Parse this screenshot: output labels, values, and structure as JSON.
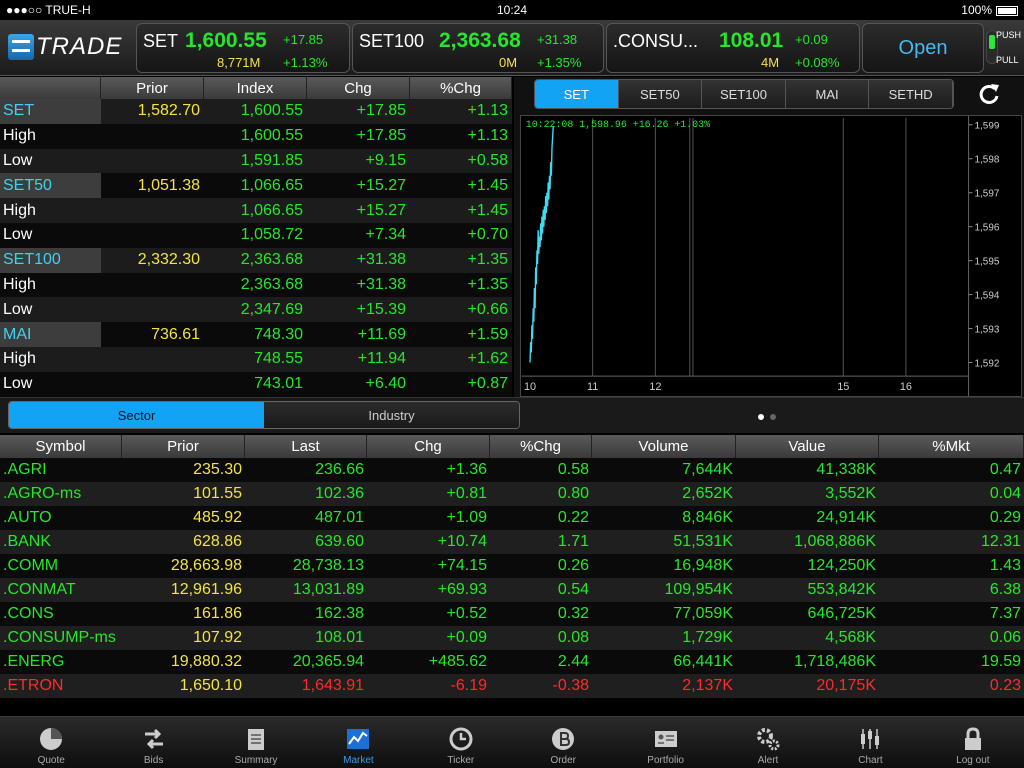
{
  "status": {
    "carrier": "●●●○○ TRUE-H",
    "time": "10:24",
    "battery": "100%"
  },
  "brand": {
    "logo_text": "TRADE"
  },
  "indices_top": [
    {
      "name": "SET",
      "value": "1,600.55",
      "change": "+17.85",
      "volume": "8,771M",
      "pct": "+1.13%"
    },
    {
      "name": "SET100",
      "value": "2,363.68",
      "change": "+31.38",
      "volume": "0M",
      "pct": "+1.35%"
    },
    {
      "name": ".CONSU...",
      "value": "108.01",
      "change": "+0.09",
      "volume": "4M",
      "pct": "+0.08%"
    }
  ],
  "market_status": "Open",
  "push": "PUSH",
  "pull": "PULL",
  "index_table": {
    "headers": [
      "",
      "Prior",
      "Index",
      "Chg",
      "%Chg"
    ],
    "rows": [
      {
        "label": "SET",
        "is_index": true,
        "prior": "1,582.70",
        "index": "1,600.55",
        "chg": "+17.85",
        "pct": "+1.13"
      },
      {
        "label": "High",
        "is_index": false,
        "prior": "",
        "index": "1,600.55",
        "chg": "+17.85",
        "pct": "+1.13"
      },
      {
        "label": "Low",
        "is_index": false,
        "prior": "",
        "index": "1,591.85",
        "chg": "+9.15",
        "pct": "+0.58"
      },
      {
        "label": "SET50",
        "is_index": true,
        "prior": "1,051.38",
        "index": "1,066.65",
        "chg": "+15.27",
        "pct": "+1.45"
      },
      {
        "label": "High",
        "is_index": false,
        "prior": "",
        "index": "1,066.65",
        "chg": "+15.27",
        "pct": "+1.45"
      },
      {
        "label": "Low",
        "is_index": false,
        "prior": "",
        "index": "1,058.72",
        "chg": "+7.34",
        "pct": "+0.70"
      },
      {
        "label": "SET100",
        "is_index": true,
        "prior": "2,332.30",
        "index": "2,363.68",
        "chg": "+31.38",
        "pct": "+1.35"
      },
      {
        "label": "High",
        "is_index": false,
        "prior": "",
        "index": "2,363.68",
        "chg": "+31.38",
        "pct": "+1.35"
      },
      {
        "label": "Low",
        "is_index": false,
        "prior": "",
        "index": "2,347.69",
        "chg": "+15.39",
        "pct": "+0.66"
      },
      {
        "label": "MAI",
        "is_index": true,
        "prior": "736.61",
        "index": "748.30",
        "chg": "+11.69",
        "pct": "+1.59"
      },
      {
        "label": "High",
        "is_index": false,
        "prior": "",
        "index": "748.55",
        "chg": "+11.94",
        "pct": "+1.62"
      },
      {
        "label": "Low",
        "is_index": false,
        "prior": "",
        "index": "743.01",
        "chg": "+6.40",
        "pct": "+0.87"
      }
    ]
  },
  "chart_tabs": [
    {
      "label": "SET",
      "active": true
    },
    {
      "label": "SET50",
      "active": false
    },
    {
      "label": "SET100",
      "active": false
    },
    {
      "label": "MAI",
      "active": false
    },
    {
      "label": "SETHD",
      "active": false
    }
  ],
  "chart_data": {
    "type": "line",
    "title": "",
    "readout": "10:22:08 1,598.96 +16.26 +1.03%",
    "x_ticks": [
      "10",
      "11",
      "12",
      "15",
      "16"
    ],
    "y_ticks": [
      "1,599",
      "1,598",
      "1,597",
      "1,596",
      "1,595",
      "1,594",
      "1,593",
      "1,592"
    ],
    "ylim": [
      1591.6,
      1599.2
    ],
    "series": [
      {
        "x": [
          10.0,
          10.01,
          10.02,
          10.03,
          10.04,
          10.05,
          10.06,
          10.07,
          10.08,
          10.09,
          10.1,
          10.11,
          10.12,
          10.13,
          10.14,
          10.15,
          10.16,
          10.17,
          10.18,
          10.19,
          10.2,
          10.21,
          10.22,
          10.23,
          10.24,
          10.25,
          10.26,
          10.27,
          10.28,
          10.29,
          10.3,
          10.31,
          10.32,
          10.33,
          10.34,
          10.35,
          10.36,
          10.37
        ],
        "y": [
          1592.0,
          1592.6,
          1592.3,
          1593.1,
          1592.7,
          1593.6,
          1593.2,
          1594.2,
          1593.6,
          1594.8,
          1594.3,
          1595.3,
          1594.9,
          1595.9,
          1595.2,
          1595.7,
          1595.4,
          1596.1,
          1595.6,
          1596.3,
          1595.8,
          1596.5,
          1596.0,
          1596.6,
          1596.2,
          1596.9,
          1596.4,
          1597.0,
          1596.6,
          1597.3,
          1596.8,
          1597.5,
          1597.1,
          1597.9,
          1597.5,
          1598.3,
          1598.6,
          1598.96
        ]
      }
    ]
  },
  "segment": {
    "sector": "Sector",
    "industry": "Industry"
  },
  "sector_table": {
    "headers": [
      "Symbol",
      "Prior",
      "Last",
      "Chg",
      "%Chg",
      "Volume",
      "Value",
      "%Mkt"
    ],
    "rows": [
      {
        "symbol": ".AGRI",
        "prior": "235.30",
        "last": "236.66",
        "chg": "+1.36",
        "pct": "0.58",
        "volume": "7,644K",
        "value": "41,338K",
        "mkt": "0.47",
        "dir": "up"
      },
      {
        "symbol": ".AGRO-ms",
        "prior": "101.55",
        "last": "102.36",
        "chg": "+0.81",
        "pct": "0.80",
        "volume": "2,652K",
        "value": "3,552K",
        "mkt": "0.04",
        "dir": "up"
      },
      {
        "symbol": ".AUTO",
        "prior": "485.92",
        "last": "487.01",
        "chg": "+1.09",
        "pct": "0.22",
        "volume": "8,846K",
        "value": "24,914K",
        "mkt": "0.29",
        "dir": "up"
      },
      {
        "symbol": ".BANK",
        "prior": "628.86",
        "last": "639.60",
        "chg": "+10.74",
        "pct": "1.71",
        "volume": "51,531K",
        "value": "1,068,886K",
        "mkt": "12.31",
        "dir": "up"
      },
      {
        "symbol": ".COMM",
        "prior": "28,663.98",
        "last": "28,738.13",
        "chg": "+74.15",
        "pct": "0.26",
        "volume": "16,948K",
        "value": "124,250K",
        "mkt": "1.43",
        "dir": "up"
      },
      {
        "symbol": ".CONMAT",
        "prior": "12,961.96",
        "last": "13,031.89",
        "chg": "+69.93",
        "pct": "0.54",
        "volume": "109,954K",
        "value": "553,842K",
        "mkt": "6.38",
        "dir": "up"
      },
      {
        "symbol": ".CONS",
        "prior": "161.86",
        "last": "162.38",
        "chg": "+0.52",
        "pct": "0.32",
        "volume": "77,059K",
        "value": "646,725K",
        "mkt": "7.37",
        "dir": "up"
      },
      {
        "symbol": ".CONSUMP-ms",
        "prior": "107.92",
        "last": "108.01",
        "chg": "+0.09",
        "pct": "0.08",
        "volume": "1,729K",
        "value": "4,568K",
        "mkt": "0.06",
        "dir": "up"
      },
      {
        "symbol": ".ENERG",
        "prior": "19,880.32",
        "last": "20,365.94",
        "chg": "+485.62",
        "pct": "2.44",
        "volume": "66,441K",
        "value": "1,718,486K",
        "mkt": "19.59",
        "dir": "up"
      },
      {
        "symbol": ".ETRON",
        "prior": "1,650.10",
        "last": "1,643.91",
        "chg": "-6.19",
        "pct": "-0.38",
        "volume": "2,137K",
        "value": "20,175K",
        "mkt": "0.23",
        "dir": "down"
      }
    ]
  },
  "tabbar": [
    {
      "label": "Quote",
      "icon": "pie-chart-icon",
      "active": false
    },
    {
      "label": "Bids",
      "icon": "swap-arrows-icon",
      "active": false
    },
    {
      "label": "Summary",
      "icon": "notepad-icon",
      "active": false
    },
    {
      "label": "Market",
      "icon": "market-chart-icon",
      "active": true
    },
    {
      "label": "Ticker",
      "icon": "clock-icon",
      "active": false
    },
    {
      "label": "Order",
      "icon": "coin-icon",
      "active": false
    },
    {
      "label": "Portfolio",
      "icon": "id-card-icon",
      "active": false
    },
    {
      "label": "Alert",
      "icon": "gears-icon",
      "active": false
    },
    {
      "label": "Chart",
      "icon": "candlestick-icon",
      "active": false
    },
    {
      "label": "Log out",
      "icon": "lock-icon",
      "active": false
    }
  ]
}
